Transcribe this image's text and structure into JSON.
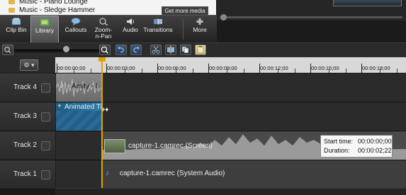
{
  "library": {
    "items": [
      {
        "label": "Music - Piano Lounge"
      },
      {
        "label": "Music - Sledge Hammer"
      }
    ],
    "get_more": "Get more media"
  },
  "toolbar": {
    "items": [
      {
        "label": "Clip Bin",
        "icon": "clip-bin-icon",
        "active": false
      },
      {
        "label": "Library",
        "icon": "library-icon",
        "active": true
      },
      {
        "label": "Callouts",
        "icon": "callouts-icon",
        "active": false
      },
      {
        "label": "Zoom-n-Pan",
        "icon": "zoom-pan-icon",
        "active": false
      },
      {
        "label": "Audio",
        "icon": "audio-icon",
        "active": false
      },
      {
        "label": "Transitions",
        "icon": "transitions-icon",
        "active": false
      },
      {
        "label": "More",
        "icon": "more-icon",
        "active": false
      }
    ]
  },
  "ruler": {
    "labels": [
      "00:00:00;00",
      "00:00:03;00",
      "00:00:06;00",
      "00:00:09;00",
      "00:00:12;00",
      "00:00:15;00",
      "00:00:18;00"
    ]
  },
  "tracks": [
    {
      "name": "Track 4",
      "clip": "Amity - I"
    },
    {
      "name": "Track 3",
      "clip": "Animated Ti"
    },
    {
      "name": "Track 2",
      "clip": "capture-1.camrec (Screen)"
    },
    {
      "name": "Track 1",
      "clip": "capture-1.camrec (System Audio)"
    }
  ],
  "tooltip": {
    "start_label": "Start time:",
    "start_value": "00:00:00;00",
    "duration_label": "Duration:",
    "duration_value": "00:00:02;22"
  },
  "colors": {
    "playhead": "#e0a400",
    "clip_blue": "#1f5a80",
    "waveform": "#8d8d8d",
    "ruler": "#d8d8d8"
  }
}
